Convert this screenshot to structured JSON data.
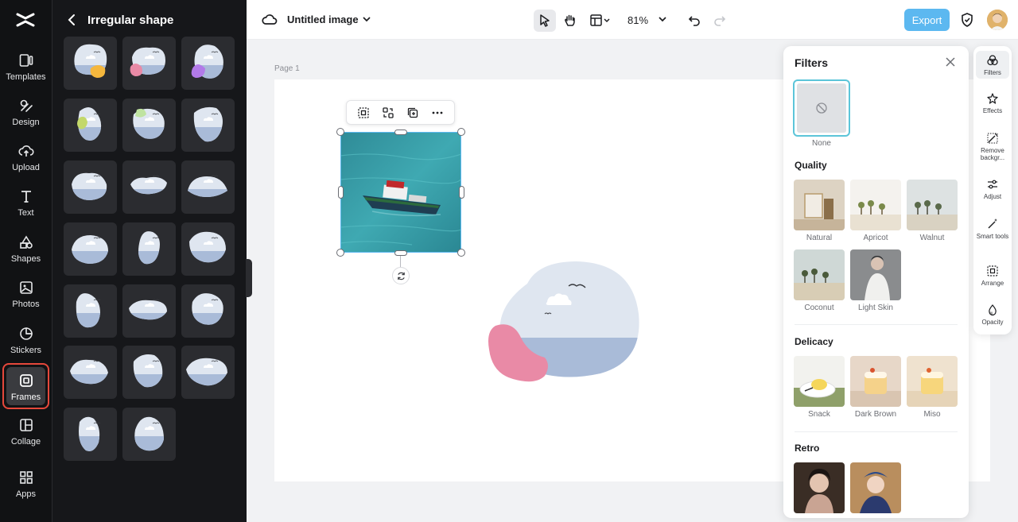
{
  "rail": {
    "items": [
      {
        "label": "Templates",
        "icon": "templates-icon"
      },
      {
        "label": "Design",
        "icon": "design-icon"
      },
      {
        "label": "Upload",
        "icon": "upload-icon"
      },
      {
        "label": "Text",
        "icon": "text-icon"
      },
      {
        "label": "Shapes",
        "icon": "shapes-icon"
      },
      {
        "label": "Photos",
        "icon": "photos-icon"
      },
      {
        "label": "Stickers",
        "icon": "stickers-icon"
      },
      {
        "label": "Frames",
        "icon": "frames-icon",
        "active": true
      },
      {
        "label": "Collage",
        "icon": "collage-icon"
      },
      {
        "label": "Apps",
        "icon": "apps-icon"
      }
    ]
  },
  "panel": {
    "title": "Irregular shape",
    "tile_count": 20
  },
  "topbar": {
    "doc_title": "Untitled image",
    "zoom": "81%",
    "export_label": "Export"
  },
  "canvas": {
    "page_label": "Page 1"
  },
  "filters": {
    "title": "Filters",
    "none_label": "None",
    "sections": [
      {
        "title": "Quality",
        "items": [
          "Natural",
          "Apricot",
          "Walnut",
          "Coconut",
          "Light Skin"
        ]
      },
      {
        "title": "Delicacy",
        "items": [
          "Snack",
          "Dark Brown",
          "Miso"
        ]
      },
      {
        "title": "Retro",
        "items": [
          "",
          ""
        ]
      }
    ]
  },
  "strip": {
    "items": [
      {
        "label": "Filters",
        "icon": "filters-icon",
        "active": true
      },
      {
        "label": "Effects",
        "icon": "effects-icon"
      },
      {
        "label": "Remove backgr...",
        "icon": "remove-background-icon"
      },
      {
        "label": "Adjust",
        "icon": "adjust-icon"
      },
      {
        "label": "Smart tools",
        "icon": "smart-tools-icon"
      },
      {
        "label": "Arrange",
        "icon": "arrange-icon"
      },
      {
        "label": "Opacity",
        "icon": "opacity-icon"
      }
    ]
  },
  "colors": {
    "accent": "#5cb8f0",
    "active_outline": "#e5483b",
    "shape_sky": "#dfe6f0",
    "shape_ground": "#a9bbd8",
    "shape_blob": "#e98aa6"
  }
}
